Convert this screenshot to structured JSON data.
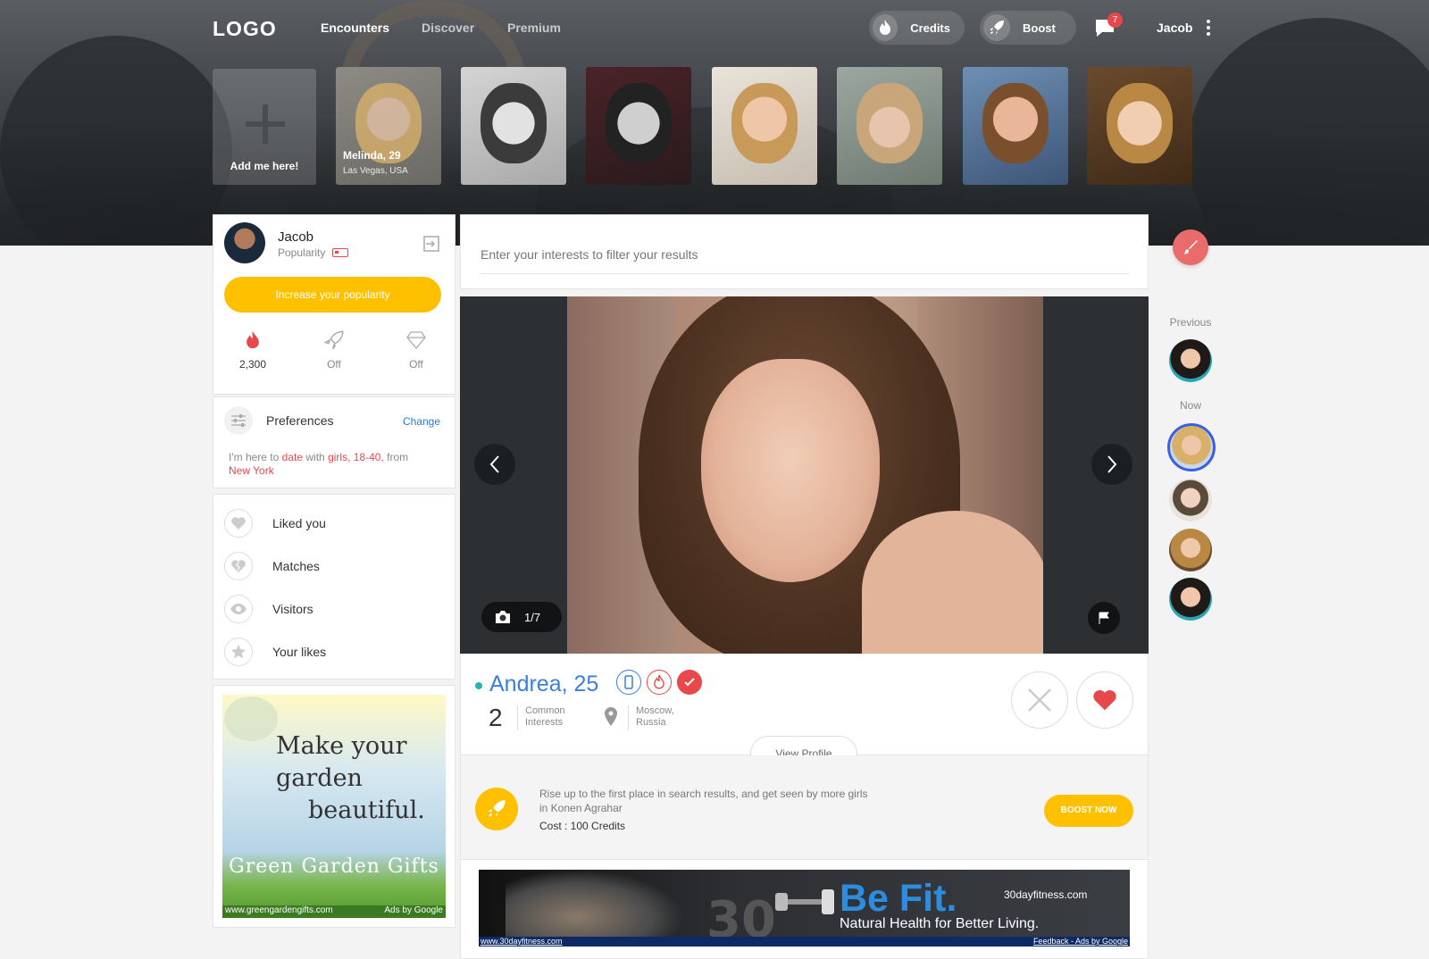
{
  "brand": {
    "logo": "LOGO"
  },
  "nav": {
    "items": [
      "Encounters",
      "Discover",
      "Premium"
    ],
    "active": "Encounters"
  },
  "header": {
    "credits_label": "Credits",
    "boost_label": "Boost",
    "messages_count": "7",
    "user_name": "Jacob"
  },
  "carousel": {
    "add_label": "Add me here!",
    "featured": {
      "name": "Melinda, 29",
      "location": "Las Vegas, USA"
    }
  },
  "me": {
    "name": "Jacob",
    "popularity_label": "Popularity",
    "increase_label": "Increase your popularity",
    "stats": [
      {
        "icon": "flame-icon",
        "value": "2,300"
      },
      {
        "icon": "rocket-icon",
        "value": "Off"
      },
      {
        "icon": "diamond-icon",
        "value": "Off"
      }
    ]
  },
  "preferences": {
    "title": "Preferences",
    "change_label": "Change",
    "line_prefix": "I'm here to",
    "intent": "date",
    "with_word": "with",
    "target": "girls, 18-40,",
    "from_word": "from",
    "city": "New York"
  },
  "menu": {
    "items": [
      "Liked you",
      "Matches",
      "Visitors",
      "Your likes"
    ]
  },
  "ad_side": {
    "headline": "Make your garden beautiful.",
    "line1": "Make your",
    "line2": "garden",
    "line3": "beautiful.",
    "brand": "Green Garden Gifts",
    "url": "www.greengardengifts.com",
    "ads_label": "Ads by Google"
  },
  "search": {
    "placeholder": "Enter your interests to filter your results"
  },
  "encounter": {
    "photo_counter": "1/7",
    "name": "Andrea, 25",
    "common_count": "2",
    "common_label_1": "Common",
    "common_label_2": "Interests",
    "location_1": "Moscow,",
    "location_2": "Russia",
    "view_profile_label": "View Profile"
  },
  "boost_promo": {
    "text": "Rise up to the first place in search results, and get seen by more girls in Konen Agrahar",
    "cost": "Cost : 100 Credits",
    "button": "BOOST NOW"
  },
  "ad_bottom": {
    "title": "Be Fit.",
    "domain": "30dayfitness.com",
    "tagline": "Natural Health for Better Living.",
    "big_number": "30",
    "url": "www.30dayfitness.com",
    "footer": "Feedback - Ads by Google"
  },
  "right_rail": {
    "previous_label": "Previous",
    "now_label": "Now"
  },
  "colors": {
    "accent_blue": "#3b7fd9",
    "boost_yellow": "#ffc000",
    "like_red": "#e8484b",
    "status_teal": "#23b5b5"
  }
}
